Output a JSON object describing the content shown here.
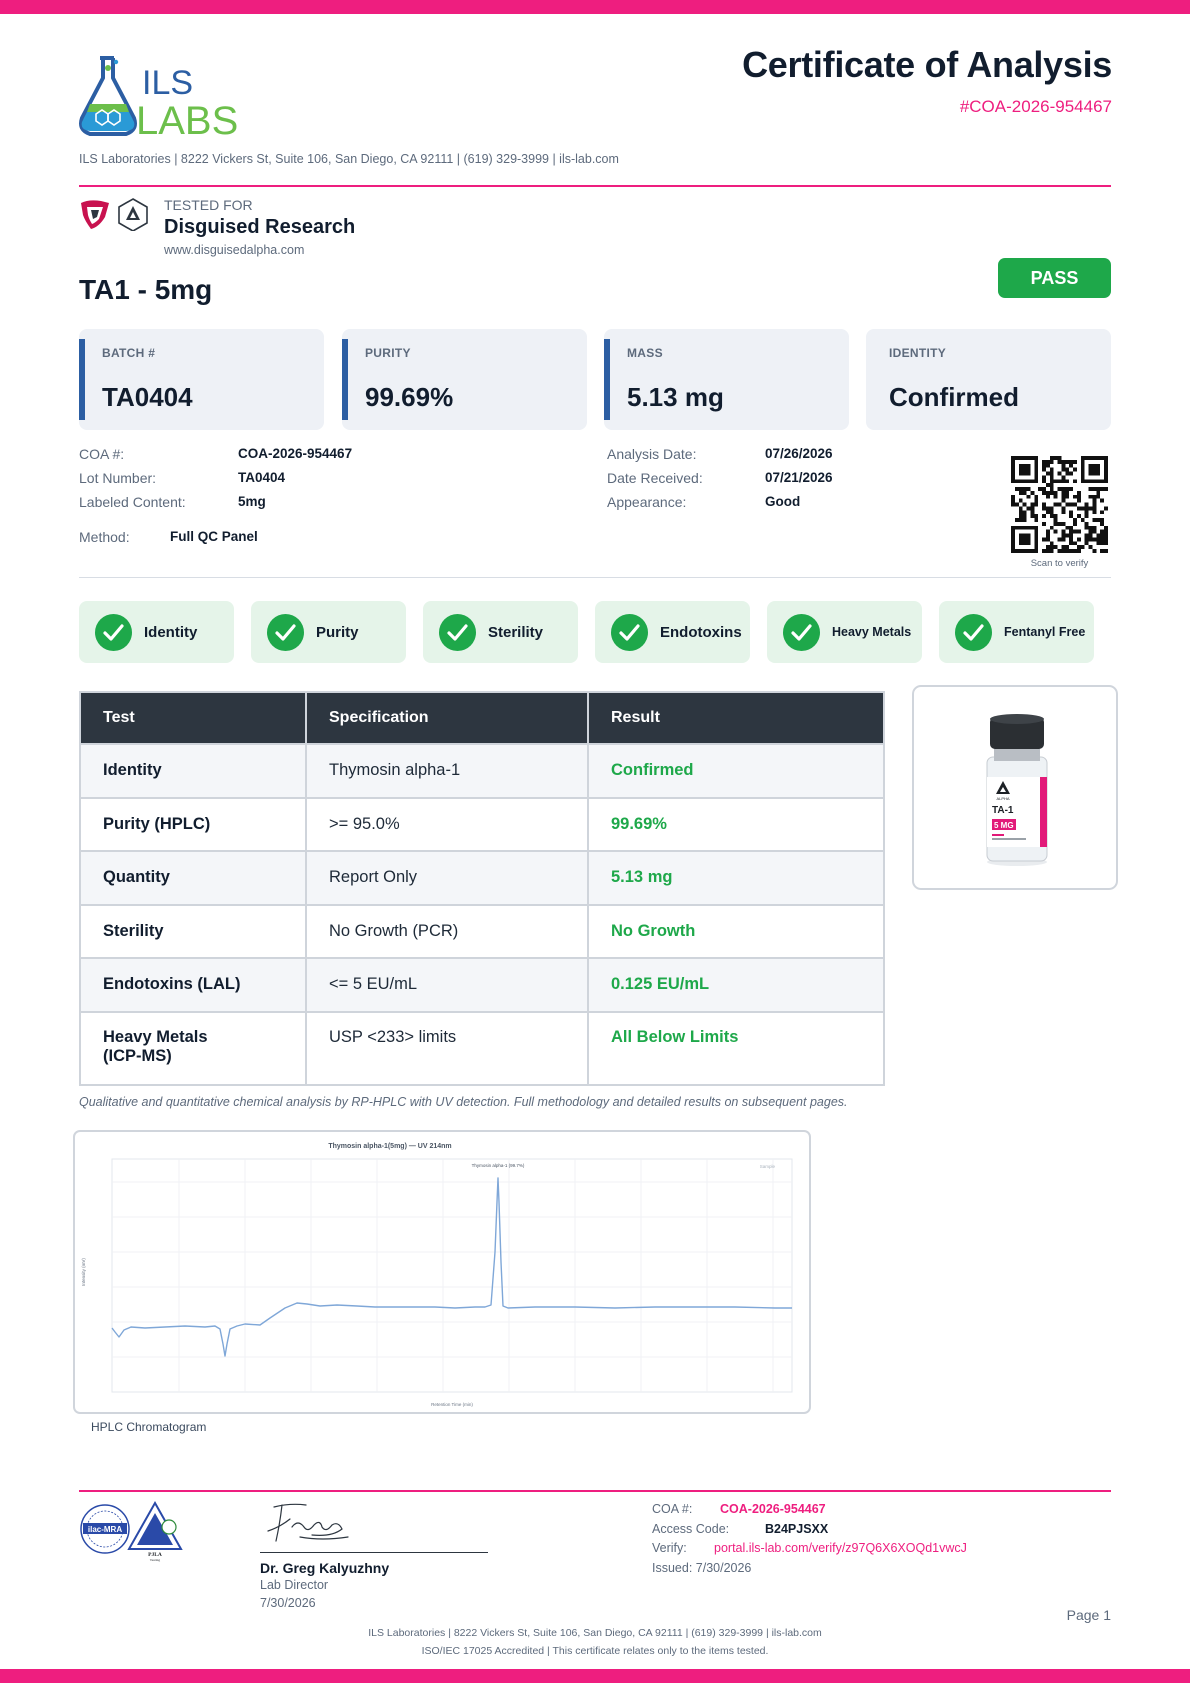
{
  "header": {
    "title": "Certificate of Analysis",
    "coa_ref": "#COA-2026-954467",
    "address_line": "ILS Laboratories  |  8222 Vickers St, Suite 106, San Diego, CA 92111  |  (619) 329-3999  |  ils-lab.com",
    "logo_text_1": "ILS",
    "logo_text_2": "LABS"
  },
  "client": {
    "tested_for_label": "TESTED FOR",
    "name": "Disguised Research",
    "url": "www.disguisedalpha.com"
  },
  "product": {
    "name": "TA1 - 5mg",
    "status": "PASS"
  },
  "cards": [
    {
      "label": "BATCH #",
      "value": "TA0404"
    },
    {
      "label": "PURITY",
      "value": "99.69%"
    },
    {
      "label": "MASS",
      "value": "5.13 mg"
    },
    {
      "label": "IDENTITY",
      "value": "Confirmed"
    }
  ],
  "details": {
    "coa_label": "COA #:",
    "coa_value": "COA-2026-954467",
    "lot_label": "Lot Number:",
    "lot_value": "TA0404",
    "labeled_label": "Labeled Content:",
    "labeled_value": "5mg",
    "method_label": "Method:",
    "method_value": "Full QC Panel",
    "analysis_label": "Analysis Date:",
    "analysis_value": "07/26/2026",
    "received_label": "Date Received:",
    "received_value": "07/21/2026",
    "appearance_label": "Appearance:",
    "appearance_value": "Good",
    "qr_caption": "Scan to verify"
  },
  "checks": [
    "Identity",
    "Purity",
    "Sterility",
    "Endotoxins",
    "Heavy Metals",
    "Fentanyl Free"
  ],
  "table": {
    "headers": [
      "Test",
      "Specification",
      "Result"
    ],
    "rows": [
      {
        "test": "Identity",
        "spec": "Thymosin alpha-1",
        "result": "Confirmed"
      },
      {
        "test": "Purity (HPLC)",
        "spec": ">= 95.0%",
        "result": "99.69%"
      },
      {
        "test": "Quantity",
        "spec": "Report Only",
        "result": "5.13 mg"
      },
      {
        "test": "Sterility",
        "spec": "No Growth (PCR)",
        "result": "No Growth"
      },
      {
        "test": "Endotoxins (LAL)",
        "spec": "<= 5 EU/mL",
        "result": "0.125 EU/mL"
      },
      {
        "test": "Heavy Metals\n(ICP-MS)",
        "spec": "USP <233> limits",
        "result": "All Below Limits"
      }
    ]
  },
  "vial": {
    "brand": "ALPHA",
    "name": "TA-1",
    "dose": "5 MG"
  },
  "method_note": "Qualitative and quantitative chemical analysis by RP-HPLC with UV detection. Full methodology and detailed results on subsequent pages.",
  "chromatogram": {
    "caption": "HPLC Chromatogram",
    "title": "Thymosin alpha-1(5mg) — UV 214nm",
    "peak_label": "Thymosin alpha-1 (99.7%)",
    "xlabel": "Retention Time (min)",
    "ylabel": "Intensity (mV)",
    "legend": "Sample"
  },
  "signature": {
    "name": "Dr. Greg Kalyuzhny",
    "role": "Lab Director",
    "date": "7/30/2026"
  },
  "verification": {
    "coa_label": "COA #:",
    "coa_value": "COA-2026-954467",
    "access_label": "Access Code:",
    "access_value": "B24PJSXX",
    "verify_label": "Verify:",
    "verify_value": "portal.ils-lab.com/verify/z97Q6X6XOQd1vwcJ",
    "issued": "Issued: 7/30/2026"
  },
  "footer": {
    "page": "Page 1",
    "line1": "ILS Laboratories  |  8222 Vickers St, Suite 106, San Diego, CA 92111  |  (619) 329-3999  |  ils-lab.com",
    "line2": "ISO/IEC 17025 Accredited  |  This certificate relates only to the items tested."
  },
  "colors": {
    "accent": "#ee1e7f",
    "pass": "#1ea84a",
    "navy": "#2c5ea3",
    "header_dark": "#2d3640"
  }
}
